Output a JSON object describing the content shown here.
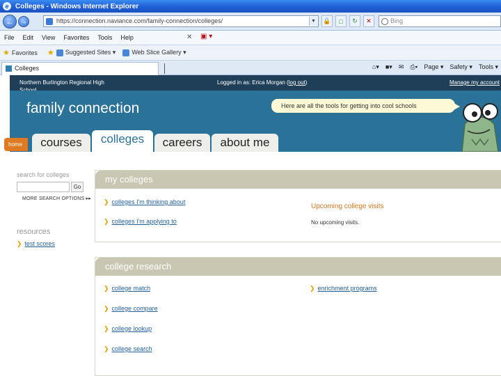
{
  "browser": {
    "title": "Colleges - Windows Internet Explorer",
    "url": "https://connection.naviance.com/family-connection/colleges/",
    "search_placeholder": "Bing",
    "menu": [
      "File",
      "Edit",
      "View",
      "Favorites",
      "Tools",
      "Help"
    ],
    "favorites_label": "Favorites",
    "favorites_items": [
      "Suggested Sites ▾",
      "Web Slice Gallery ▾"
    ],
    "tab_title": "Colleges",
    "command_bar": [
      "Page ▾",
      "Safety ▾",
      "Tools ▾"
    ]
  },
  "site": {
    "school_name": "Northern Burlington Regional High School",
    "logged_in_prefix": "Logged in as: Erica Morgan (",
    "logout_label": "log out",
    "logged_in_suffix": ")",
    "manage_account": "Manage my account",
    "brand": "family connection",
    "tagline": "Here are all the tools for getting into cool schools",
    "home_tab": "home",
    "nav_tabs": [
      "courses",
      "colleges",
      "careers",
      "about me"
    ],
    "active_tab": "colleges"
  },
  "sidebar": {
    "search_label": "search for colleges",
    "go_button": "Go",
    "more_options": "MORE SEARCH OPTIONS ▸▸",
    "resources_heading": "resources",
    "resource_links": [
      "test scores"
    ]
  },
  "my_colleges": {
    "heading": "my colleges",
    "links": [
      "colleges I'm thinking about",
      "colleges I'm applying to"
    ],
    "upcoming_heading": "Upcoming college visits",
    "upcoming_text": "No upcoming visits."
  },
  "college_research": {
    "heading": "college research",
    "links": [
      "college match",
      "college compare",
      "college lookup",
      "college search"
    ],
    "enrichment_link": "enrichment programs"
  },
  "colors": {
    "band": "#2a7297",
    "top_strip": "#1f3f58",
    "panel_header": "#c9c6b2",
    "accent_orange": "#e07a22",
    "link_blue": "#1f5f9a"
  }
}
